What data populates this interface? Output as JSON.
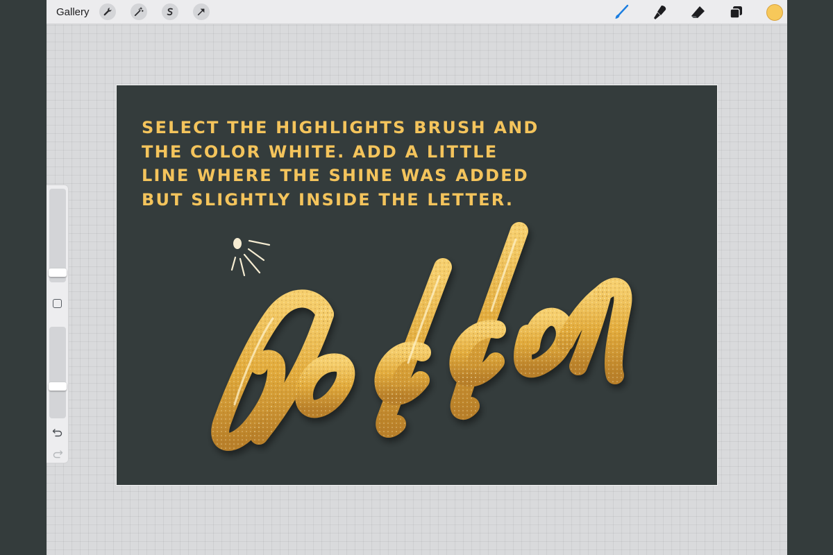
{
  "topbar": {
    "gallery_label": "Gallery",
    "left_tools": [
      {
        "name": "wrench-icon",
        "label": "Actions"
      },
      {
        "name": "magic-wand-icon",
        "label": "Adjustments"
      },
      {
        "name": "selection-icon",
        "label": "Selection"
      },
      {
        "name": "transform-arrow-icon",
        "label": "Transform"
      }
    ],
    "right_tools": [
      {
        "name": "brush-icon",
        "active": true
      },
      {
        "name": "smudge-icon",
        "active": false
      },
      {
        "name": "eraser-icon",
        "active": false
      },
      {
        "name": "layers-icon",
        "active": false
      }
    ],
    "current_color": "#f7c85a"
  },
  "sidebar": {
    "brush_size_level": 0.13,
    "opacity_level": 0.35
  },
  "canvas": {
    "background_color": "#343c3c",
    "instruction_lines": [
      "SELECT THE HIGHLIGHTS BRUSH AND",
      "THE COLOR WHITE. ADD A LITTLE",
      "LINE WHERE THE SHINE WAS ADDED",
      "BUT SLIGHTLY INSIDE THE LETTER."
    ],
    "instruction_color": "#f4c45c",
    "lettering": "Golden",
    "lettering_color": "#e0a93a"
  }
}
